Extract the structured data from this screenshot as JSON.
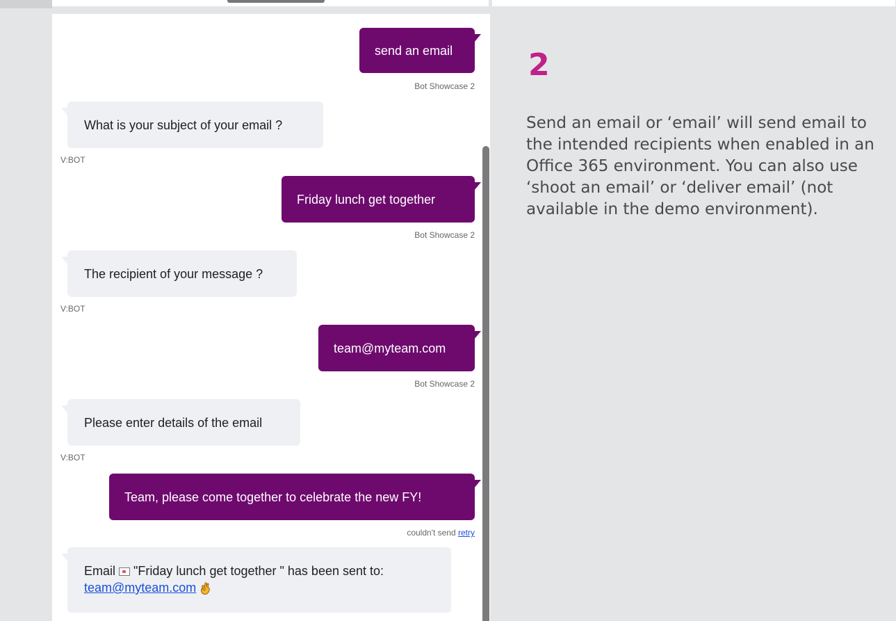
{
  "messages": [
    {
      "type": "user",
      "text": "send an email",
      "meta": "Bot Showcase 2"
    },
    {
      "type": "bot",
      "text": "What is your subject of your email ?",
      "meta": "V:BOT"
    },
    {
      "type": "user",
      "text": "Friday lunch get together",
      "meta": "Bot Showcase 2"
    },
    {
      "type": "bot",
      "text": "The recipient of your message ?",
      "meta": "V:BOT"
    },
    {
      "type": "user",
      "text": "team@myteam.com",
      "meta": "Bot Showcase 2"
    },
    {
      "type": "bot",
      "text": "Please enter details of the email",
      "meta": "V:BOT"
    },
    {
      "type": "user",
      "text": "Team, please come together to celebrate the new FY!",
      "meta_prefix": "couldn't send",
      "meta_link": "retry"
    },
    {
      "type": "bot",
      "text_prefix": "Email",
      "text_subject": "\"Friday lunch get together \" has been sent to:",
      "text_link": "team@myteam.com"
    }
  ],
  "step": {
    "number": "2",
    "description": "Send an email or ‘email’ will send email to the intended recipients when enabled in an Office 365 environment. You can also use ‘shoot an email’ or ‘deliver email’ (not available in the demo environment)."
  },
  "icons": {
    "envelope": "envelope-icon",
    "ok_hand": "ok-hand-icon"
  },
  "colors": {
    "user_bubble": "#6e0a6e",
    "bot_bubble": "#eef0f3",
    "step_number": "#c0208a",
    "link": "#1a4fd6"
  }
}
